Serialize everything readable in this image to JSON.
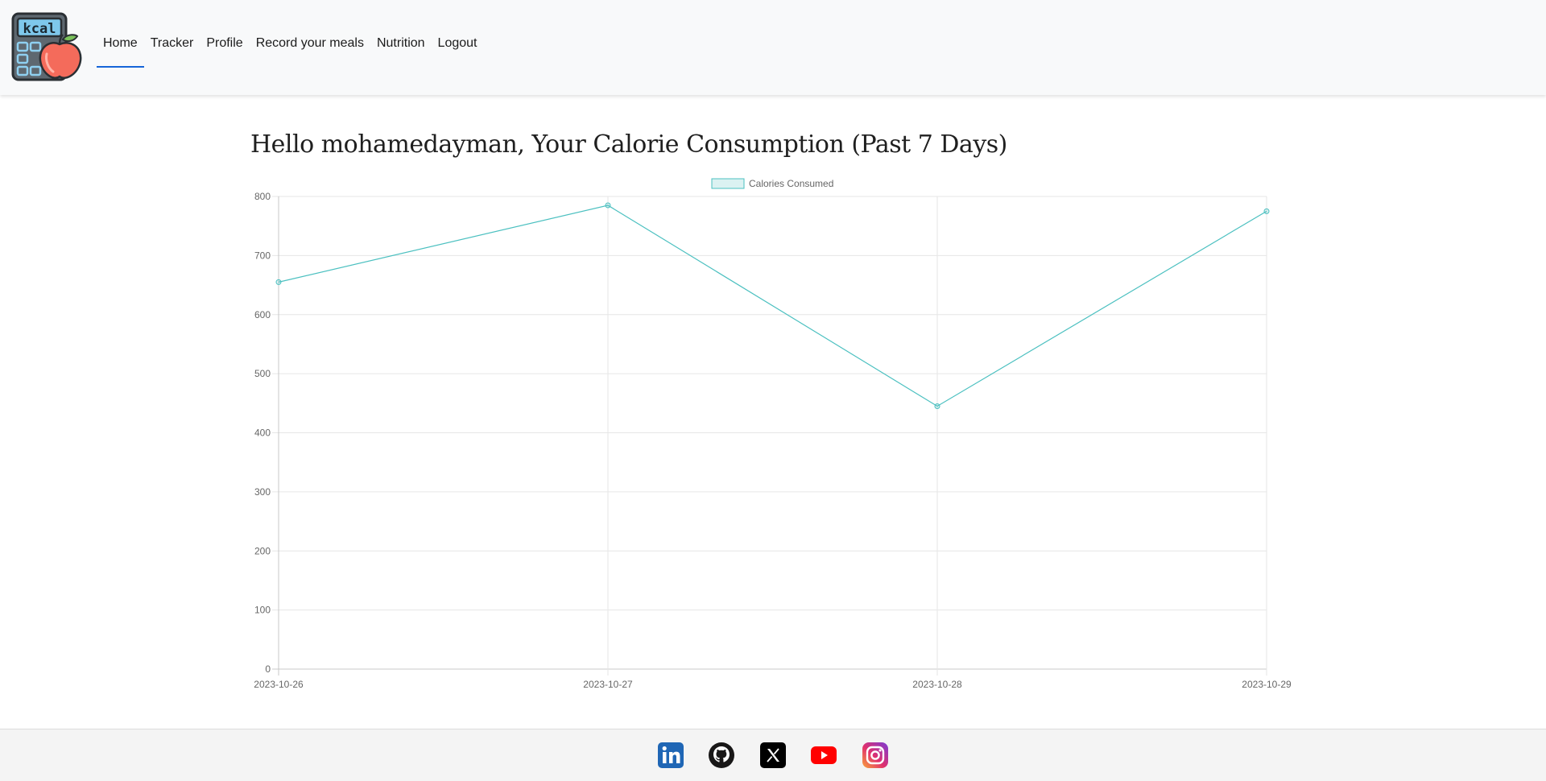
{
  "nav": {
    "logo_text": "kcal",
    "items": [
      {
        "label": "Home",
        "active": true
      },
      {
        "label": "Tracker",
        "active": false
      },
      {
        "label": "Profile",
        "active": false
      },
      {
        "label": "Record your meals",
        "active": false
      },
      {
        "label": "Nutrition",
        "active": false
      },
      {
        "label": "Logout",
        "active": false
      }
    ]
  },
  "main": {
    "title": "Hello mohamedayman, Your Calorie Consumption (Past 7 Days)"
  },
  "chart_data": {
    "type": "line",
    "title": "",
    "x": [
      "2023-10-26",
      "2023-10-27",
      "2023-10-28",
      "2023-10-29"
    ],
    "series": [
      {
        "name": "Calories Consumed",
        "values": [
          655,
          785,
          445,
          775
        ],
        "color": "#4bc0c0"
      }
    ],
    "ylim": [
      0,
      800
    ],
    "yticks": [
      0,
      100,
      200,
      300,
      400,
      500,
      600,
      700,
      800
    ],
    "grid": true,
    "legend": "top-center",
    "xlabel": "",
    "ylabel": ""
  },
  "footer": {
    "icons": [
      "linkedin-icon",
      "github-icon",
      "x-icon",
      "youtube-icon",
      "instagram-icon"
    ]
  }
}
